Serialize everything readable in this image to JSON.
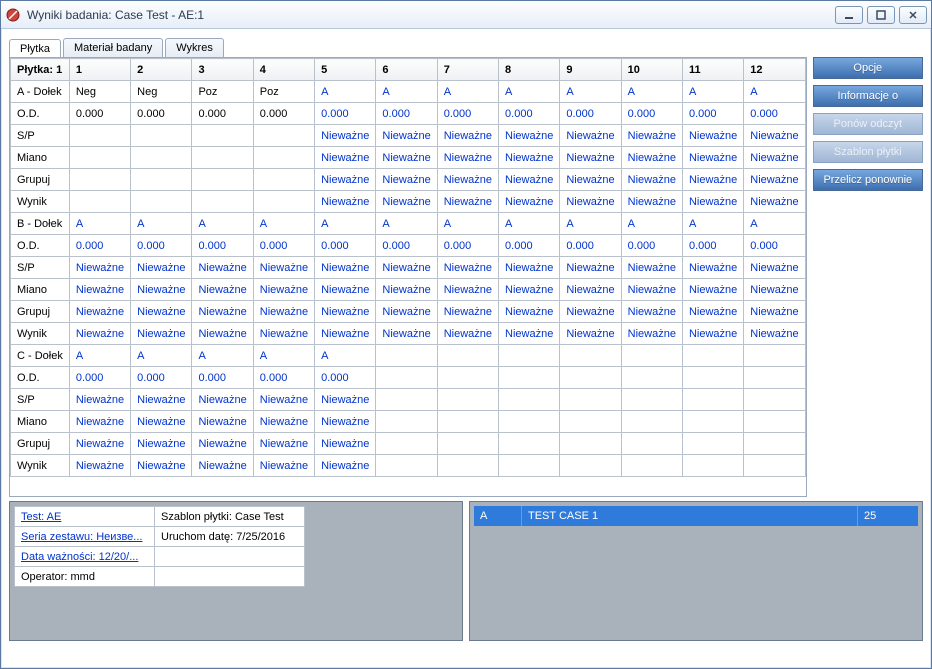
{
  "window": {
    "title": "Wyniki badania: Case Test - AE:1"
  },
  "tabs": [
    {
      "label": "Płytka",
      "active": true
    },
    {
      "label": "Materiał badany",
      "active": false
    },
    {
      "label": "Wykres",
      "active": false
    }
  ],
  "side_buttons": [
    {
      "key": "opcje",
      "label": "Opcje",
      "disabled": false
    },
    {
      "key": "info",
      "label": "Informacje o",
      "disabled": false
    },
    {
      "key": "ponow",
      "label": "Ponów odczyt",
      "disabled": true
    },
    {
      "key": "szablon",
      "label": "Szablon płytki",
      "disabled": true
    },
    {
      "key": "przelicz",
      "label": "Przelicz ponownie",
      "disabled": false
    }
  ],
  "grid": {
    "corner": "Płytka: 1",
    "columns": [
      "1",
      "2",
      "3",
      "4",
      "5",
      "6",
      "7",
      "8",
      "9",
      "10",
      "11",
      "12"
    ],
    "rows": [
      {
        "label": "A - Dołek",
        "cells": [
          "Neg",
          "Neg",
          "Poz",
          "Poz",
          "A",
          "A",
          "A",
          "A",
          "A",
          "A",
          "A",
          "A"
        ],
        "blue_from": 4
      },
      {
        "label": "O.D.",
        "cells": [
          "0.000",
          "0.000",
          "0.000",
          "0.000",
          "0.000",
          "0.000",
          "0.000",
          "0.000",
          "0.000",
          "0.000",
          "0.000",
          "0.000"
        ],
        "blue_from": 4
      },
      {
        "label": "S/P",
        "cells": [
          "",
          "",
          "",
          "",
          "Nieważne",
          "Nieważne",
          "Nieważne",
          "Nieważne",
          "Nieważne",
          "Nieważne",
          "Nieważne",
          "Nieważne"
        ],
        "blue_from": 4
      },
      {
        "label": "Miano",
        "cells": [
          "",
          "",
          "",
          "",
          "Nieważne",
          "Nieważne",
          "Nieważne",
          "Nieważne",
          "Nieważne",
          "Nieważne",
          "Nieważne",
          "Nieważne"
        ],
        "blue_from": 4
      },
      {
        "label": "Grupuj",
        "cells": [
          "",
          "",
          "",
          "",
          "Nieważne",
          "Nieważne",
          "Nieważne",
          "Nieważne",
          "Nieważne",
          "Nieważne",
          "Nieważne",
          "Nieważne"
        ],
        "blue_from": 4
      },
      {
        "label": "Wynik",
        "cells": [
          "",
          "",
          "",
          "",
          "Nieważne",
          "Nieważne",
          "Nieważne",
          "Nieważne",
          "Nieważne",
          "Nieważne",
          "Nieważne",
          "Nieważne"
        ],
        "blue_from": 4
      },
      {
        "label": "B - Dołek",
        "cells": [
          "A",
          "A",
          "A",
          "A",
          "A",
          "A",
          "A",
          "A",
          "A",
          "A",
          "A",
          "A"
        ],
        "blue_from": 0
      },
      {
        "label": "O.D.",
        "cells": [
          "0.000",
          "0.000",
          "0.000",
          "0.000",
          "0.000",
          "0.000",
          "0.000",
          "0.000",
          "0.000",
          "0.000",
          "0.000",
          "0.000"
        ],
        "blue_from": 0
      },
      {
        "label": "S/P",
        "cells": [
          "Nieważne",
          "Nieważne",
          "Nieważne",
          "Nieważne",
          "Nieważne",
          "Nieważne",
          "Nieważne",
          "Nieważne",
          "Nieważne",
          "Nieważne",
          "Nieważne",
          "Nieważne"
        ],
        "blue_from": 0
      },
      {
        "label": "Miano",
        "cells": [
          "Nieważne",
          "Nieważne",
          "Nieważne",
          "Nieważne",
          "Nieważne",
          "Nieważne",
          "Nieważne",
          "Nieważne",
          "Nieważne",
          "Nieważne",
          "Nieważne",
          "Nieważne"
        ],
        "blue_from": 0
      },
      {
        "label": "Grupuj",
        "cells": [
          "Nieważne",
          "Nieważne",
          "Nieważne",
          "Nieważne",
          "Nieważne",
          "Nieważne",
          "Nieważne",
          "Nieważne",
          "Nieważne",
          "Nieważne",
          "Nieważne",
          "Nieważne"
        ],
        "blue_from": 0
      },
      {
        "label": "Wynik",
        "cells": [
          "Nieważne",
          "Nieważne",
          "Nieważne",
          "Nieważne",
          "Nieważne",
          "Nieważne",
          "Nieważne",
          "Nieważne",
          "Nieważne",
          "Nieważne",
          "Nieważne",
          "Nieważne"
        ],
        "blue_from": 0
      },
      {
        "label": "C - Dołek",
        "cells": [
          "A",
          "A",
          "A",
          "A",
          "A",
          "",
          "",
          "",
          "",
          "",
          "",
          ""
        ],
        "blue_from": 0
      },
      {
        "label": "O.D.",
        "cells": [
          "0.000",
          "0.000",
          "0.000",
          "0.000",
          "0.000",
          "",
          "",
          "",
          "",
          "",
          "",
          ""
        ],
        "blue_from": 0
      },
      {
        "label": "S/P",
        "cells": [
          "Nieważne",
          "Nieważne",
          "Nieważne",
          "Nieważne",
          "Nieważne",
          "",
          "",
          "",
          "",
          "",
          "",
          ""
        ],
        "blue_from": 0
      },
      {
        "label": "Miano",
        "cells": [
          "Nieważne",
          "Nieważne",
          "Nieważne",
          "Nieważne",
          "Nieważne",
          "",
          "",
          "",
          "",
          "",
          "",
          ""
        ],
        "blue_from": 0
      },
      {
        "label": "Grupuj",
        "cells": [
          "Nieważne",
          "Nieważne",
          "Nieważne",
          "Nieważne",
          "Nieważne",
          "",
          "",
          "",
          "",
          "",
          "",
          ""
        ],
        "blue_from": 0
      },
      {
        "label": "Wynik",
        "cells": [
          "Nieważne",
          "Nieważne",
          "Nieważne",
          "Nieważne",
          "Nieważne",
          "",
          "",
          "",
          "",
          "",
          "",
          ""
        ],
        "blue_from": 0
      }
    ]
  },
  "info": {
    "rows": [
      {
        "label": "Test: AE",
        "link": true,
        "value": "Szablon płytki: Case Test"
      },
      {
        "label": "Seria zestawu: Неизве...",
        "link": true,
        "value": "Uruchom datę: 7/25/2016"
      },
      {
        "label": "Data ważności: 12/20/...",
        "link": true,
        "value": ""
      },
      {
        "label": "Operator: mmd",
        "link": false,
        "value": ""
      }
    ]
  },
  "case": {
    "col_a": "A",
    "name": "TEST CASE 1",
    "count": "25"
  }
}
